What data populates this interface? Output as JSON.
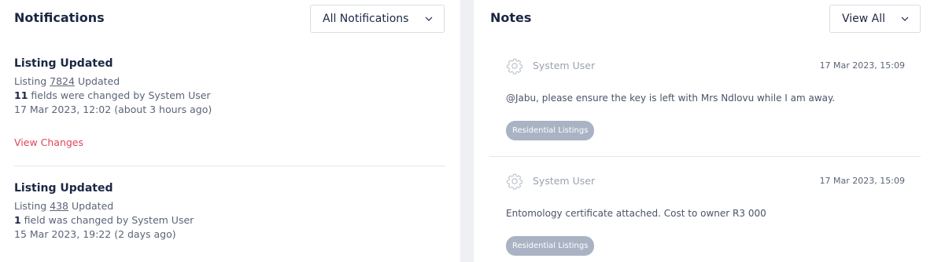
{
  "notifications": {
    "title": "Notifications",
    "filter_label": "All Notifications",
    "items": [
      {
        "title": "Listing Updated",
        "listing_prefix": "Listing ",
        "listing_id": "7824",
        "listing_suffix": " Updated",
        "field_count": "11",
        "field_text": " fields were changed by System User",
        "timestamp": "17 Mar 2023, 12:02 (about 3 hours ago)",
        "action": "View Changes"
      },
      {
        "title": "Listing Updated",
        "listing_prefix": "Listing ",
        "listing_id": "438",
        "listing_suffix": " Updated",
        "field_count": "1",
        "field_text": " field was changed by System User",
        "timestamp": "15 Mar 2023, 19:22 (2 days ago)"
      }
    ]
  },
  "notes": {
    "title": "Notes",
    "filter_label": "View All",
    "items": [
      {
        "author": "System User",
        "date": "17 Mar 2023, 15:09",
        "text": "@Jabu, please ensure the key is left with Mrs Ndlovu while I am away.",
        "tag": "Residential Listings",
        "icon": "gear-icon"
      },
      {
        "author": "System User",
        "date": "17 Mar 2023, 15:09",
        "text": "Entomology certificate attached. Cost to owner R3 000",
        "tag": "Residential Listings",
        "icon": "gear-icon"
      }
    ]
  }
}
